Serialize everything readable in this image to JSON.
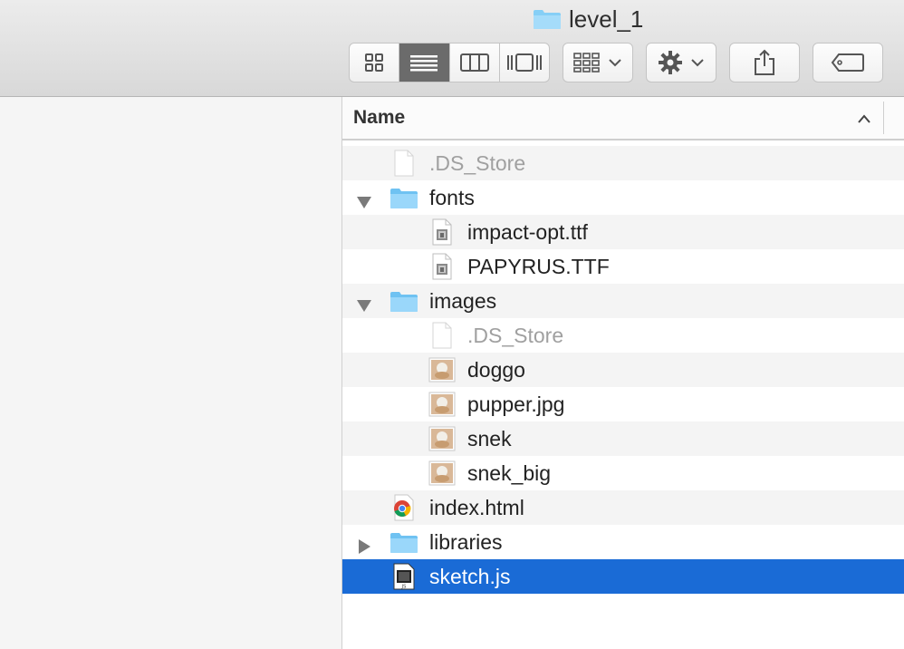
{
  "window": {
    "title": "level_1"
  },
  "toolbar": {
    "view_buttons": [
      "icon-view",
      "list-view",
      "column-view",
      "cover-flow-view"
    ],
    "active_view": "list-view",
    "arrange_icon": "arrange-grid-icon",
    "action_icon": "gear-icon",
    "share_icon": "share-icon",
    "tag_icon": "tag-icon"
  },
  "list_header": {
    "name": "Name",
    "sort": "ascending"
  },
  "rows": [
    {
      "label": ".DS_Store",
      "icon": "blank-file-icon",
      "depth": 0,
      "dimmed": true
    },
    {
      "label": "fonts",
      "icon": "folder-icon",
      "depth": 0,
      "disclosure": "expanded"
    },
    {
      "label": "impact-opt.ttf",
      "icon": "font-file-icon",
      "depth": 1
    },
    {
      "label": "PAPYRUS.TTF",
      "icon": "font-file-icon",
      "depth": 1
    },
    {
      "label": "images",
      "icon": "folder-icon",
      "depth": 0,
      "disclosure": "expanded"
    },
    {
      "label": ".DS_Store",
      "icon": "blank-file-icon",
      "depth": 1,
      "dimmed": true
    },
    {
      "label": "doggo",
      "icon": "image-thumbnail-icon",
      "depth": 1
    },
    {
      "label": "pupper.jpg",
      "icon": "image-thumbnail-icon",
      "depth": 1
    },
    {
      "label": "snek",
      "icon": "image-thumbnail-icon",
      "depth": 1
    },
    {
      "label": "snek_big",
      "icon": "image-thumbnail-icon",
      "depth": 1
    },
    {
      "label": "index.html",
      "icon": "chrome-html-icon",
      "depth": 0
    },
    {
      "label": "libraries",
      "icon": "folder-icon",
      "depth": 0,
      "disclosure": "collapsed"
    },
    {
      "label": "sketch.js",
      "icon": "js-file-icon",
      "depth": 0,
      "selected": true
    }
  ],
  "colors": {
    "selection": "#1a6bd6",
    "folder": "#7ccbf5",
    "alt_row": "#f4f4f4"
  }
}
